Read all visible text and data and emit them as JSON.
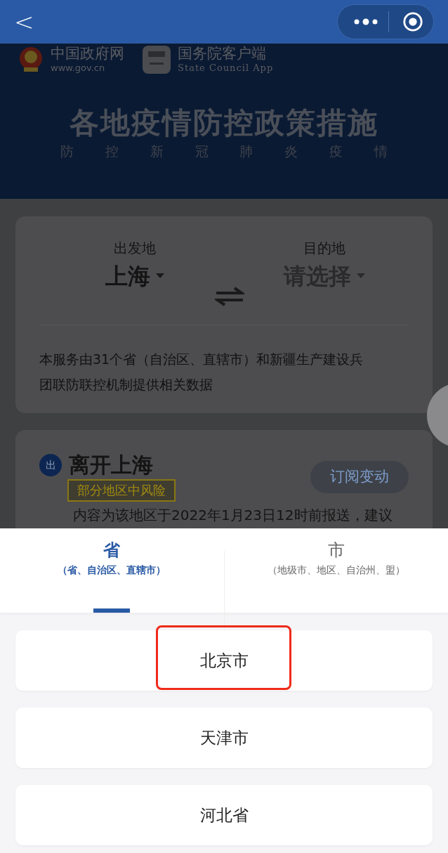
{
  "nav_bar": {
    "back": "<"
  },
  "header": {
    "logos": [
      {
        "title": "中国政府网",
        "subtitle": "www.gov.cn",
        "kind": "emblem"
      },
      {
        "title": "国务院客户端",
        "subtitle": "State Council App",
        "kind": "app"
      }
    ],
    "title": "各地疫情防控政策措施",
    "subtitle": [
      "防",
      "控",
      "新",
      "冠",
      "肺",
      "炎",
      "疫",
      "情"
    ]
  },
  "route_card": {
    "origin_label": "出发地",
    "origin_value": "上海",
    "destination_label": "目的地",
    "destination_placeholder": "请选择",
    "note": "本服务由31个省（自治区、直辖市）和新疆生产建设兵团联防联控机制提供相关数据"
  },
  "policy_card": {
    "badge": "出",
    "title": "离开上海",
    "risk_tag": "部分地区中风险",
    "subscribe_button": "订阅变动",
    "text": "内容为该地区于2022年1月23日12时前报送，建议"
  },
  "picker": {
    "tabs": [
      {
        "label": "省",
        "hint": "（省、自治区、直辖市）",
        "selected": true
      },
      {
        "label": "市",
        "hint": "（地级市、地区、自治州、盟）",
        "selected": false
      }
    ],
    "items": [
      {
        "label": "北京市",
        "highlighted": true
      },
      {
        "label": "天津市",
        "highlighted": false
      },
      {
        "label": "河北省",
        "highlighted": false
      }
    ]
  }
}
